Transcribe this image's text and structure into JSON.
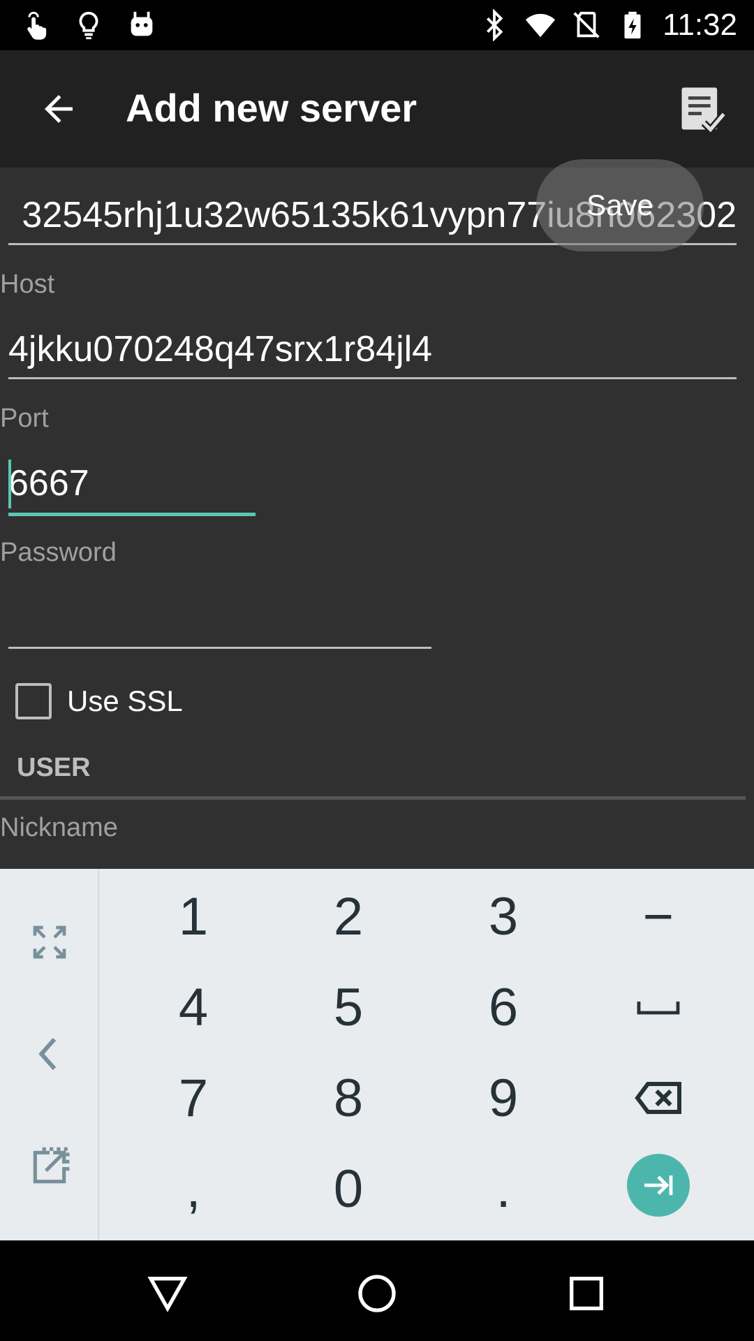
{
  "status_bar": {
    "time": "11:32",
    "left_icons": [
      "touch-icon",
      "lightbulb-icon",
      "android-icon"
    ],
    "right_icons": [
      "bluetooth-icon",
      "wifi-icon",
      "no-sim-icon",
      "battery-charging-icon"
    ]
  },
  "action_bar": {
    "title": "Add new server",
    "back_icon": "arrow-back-icon",
    "save_icon": "checklist-save-icon"
  },
  "toast": {
    "text": "Save"
  },
  "form": {
    "name_value": "32545rhj1u32w65135k61vypn77iu8n062302",
    "host_label": "Host",
    "host_value": "4jkku070248q47srx1r84jl4",
    "port_label": "Port",
    "port_value": "6667",
    "password_label": "Password",
    "password_value": "",
    "ssl_label": "Use SSL",
    "ssl_checked": false,
    "user_section": "USER",
    "nickname_label": "Nickname"
  },
  "keyboard": {
    "side_buttons": [
      "expand-icon",
      "chevron-left-icon",
      "open-external-icon"
    ],
    "rows": [
      [
        "1",
        "2",
        "3",
        "−"
      ],
      [
        "4",
        "5",
        "6",
        "space-icon"
      ],
      [
        "7",
        "8",
        "9",
        "backspace-icon"
      ],
      [
        ",",
        "0",
        ".",
        "next-icon"
      ]
    ]
  },
  "nav_bar": {
    "buttons": [
      "back-triangle-icon",
      "home-circle-icon",
      "recents-square-icon"
    ]
  },
  "colors": {
    "accent": "#5cc7b3",
    "enter_key": "#4db6ac",
    "background": "#303030",
    "action_bar": "#212121",
    "keyboard_bg": "#e8ecef"
  }
}
